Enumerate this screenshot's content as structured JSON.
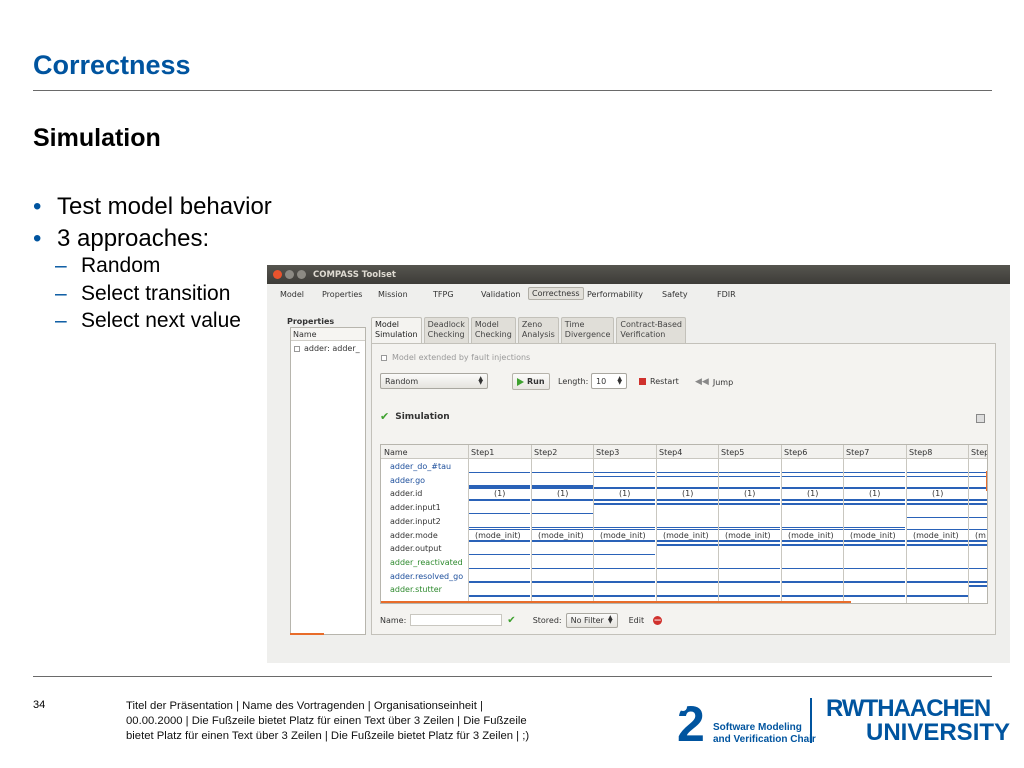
{
  "slide": {
    "title": "Correctness",
    "subtitle": "Simulation",
    "bullets": [
      "Test model behavior",
      "3 approaches:"
    ],
    "sub_bullets": [
      "Random",
      "Select transition",
      "Select next value"
    ],
    "bullet_marker": "•",
    "sub_marker": "–"
  },
  "app": {
    "window_title": "COMPASS Toolset",
    "menu": [
      "Model",
      "Properties",
      "Mission",
      "TFPG",
      "Validation",
      "Correctness",
      "Performability",
      "Safety",
      "FDIR"
    ],
    "properties_label": "Properties",
    "properties_column": "Name",
    "properties_item": "adder: adder_",
    "tabs": [
      {
        "l1": "Model",
        "l2": "Simulation"
      },
      {
        "l1": "Deadlock",
        "l2": "Checking"
      },
      {
        "l1": "Model",
        "l2": "Checking"
      },
      {
        "l1": "Zeno",
        "l2": "Analysis"
      },
      {
        "l1": "Time",
        "l2": "Divergence"
      },
      {
        "l1": "Contract-Based",
        "l2": "Verification"
      }
    ],
    "fault_checkbox": "Model extended by fault injections",
    "mode_select": "Random",
    "run_label": "Run",
    "length_label": "Length:",
    "length_value": "10",
    "restart_label": "Restart",
    "jump_label": "Jump",
    "simulation_heading": "Simulation",
    "grid_columns": [
      "Name",
      "Step1",
      "Step2",
      "Step3",
      "Step4",
      "Step5",
      "Step6",
      "Step7",
      "Step8",
      "Step"
    ],
    "signals": [
      {
        "name": "adder_do_#tau",
        "kind": "blue"
      },
      {
        "name": "adder.go",
        "kind": "blue"
      },
      {
        "name": "adder.id",
        "kind": "dark"
      },
      {
        "name": "adder.input1",
        "kind": "dark"
      },
      {
        "name": "adder.input2",
        "kind": "dark"
      },
      {
        "name": "adder.mode",
        "kind": "dark"
      },
      {
        "name": "adder.output",
        "kind": "dark"
      },
      {
        "name": "adder_reactivated",
        "kind": "green"
      },
      {
        "name": "adder.resolved_go",
        "kind": "blue"
      },
      {
        "name": "adder.stutter",
        "kind": "green"
      }
    ],
    "id_value": "(1)",
    "mode_value": "(mode_init)",
    "mode_value_cut": "(m",
    "name_label": "Name:",
    "stored_label": "Stored:",
    "filter_select": "No Filter",
    "edit_label": "Edit"
  },
  "footer": {
    "page_number": "34",
    "line1": "Titel der Präsentation  |  Name des Vortragenden  |  Organisationseinheit  |",
    "line2": "00.00.2000  |  Die Fußzeile bietet Platz für einen Text über 3 Zeilen  |  Die Fußzeile",
    "line3": "bietet Platz für einen Text über 3 Zeilen  |  Die Fußzeile bietet Platz für 3 Zeilen  | ;)",
    "chair_line1": "Software Modeling",
    "chair_line2": "and Verification Chair",
    "logo_digit": "2",
    "rwth_line1": "RWTHAACHEN",
    "rwth_line2": "UNIVERSITY"
  },
  "colors": {
    "rwth_blue": "#00549f",
    "signal_blue": "#2a62b8",
    "accent_orange": "#e86c2a",
    "run_green": "#3ea12f",
    "stop_red": "#d0312d"
  }
}
